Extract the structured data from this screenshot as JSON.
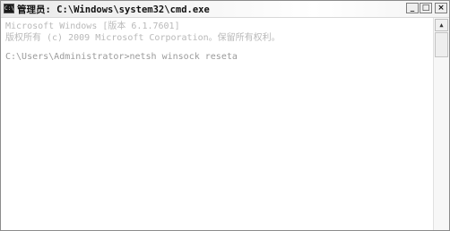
{
  "window": {
    "title": "管理员: C:\\Windows\\system32\\cmd.exe",
    "icon_label": "C:\\",
    "buttons": {
      "minimize": "_",
      "maximize": "□",
      "close": "×"
    }
  },
  "console": {
    "lines": [
      "Microsoft Windows [版本 6.1.7601]",
      "版权所有 (c) 2009 Microsoft Corporation。保留所有权利。",
      "C:\\Users\\Administrator>netsh winsock reseta"
    ]
  },
  "scrollbar": {
    "up_arrow": "▲"
  },
  "colors": {
    "console_background": "#ffffff",
    "console_text": "#b9b9b9",
    "titlebar": "#e9e9e9"
  }
}
